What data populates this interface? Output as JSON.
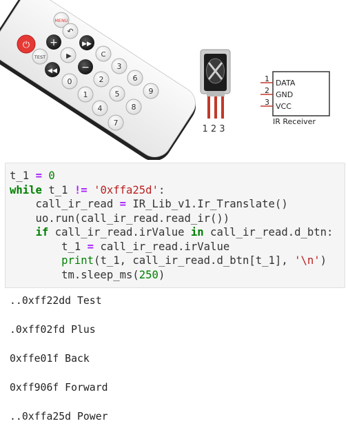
{
  "remote": {
    "buttons": [
      {
        "name": "power",
        "label": ""
      },
      {
        "name": "menu",
        "label": "MENU"
      },
      {
        "name": "test",
        "label": "TEST"
      },
      {
        "name": "plus",
        "label": "+"
      },
      {
        "name": "back",
        "label": ""
      },
      {
        "name": "play",
        "label": ""
      },
      {
        "name": "forward",
        "label": ""
      },
      {
        "name": "rewind",
        "label": ""
      },
      {
        "name": "minus",
        "label": "−"
      },
      {
        "name": "clear",
        "label": "C"
      },
      {
        "name": "0",
        "label": "0"
      },
      {
        "name": "1",
        "label": "1"
      },
      {
        "name": "2",
        "label": "2"
      },
      {
        "name": "3",
        "label": "3"
      },
      {
        "name": "4",
        "label": "4"
      },
      {
        "name": "5",
        "label": "5"
      },
      {
        "name": "6",
        "label": "6"
      },
      {
        "name": "7",
        "label": "7"
      },
      {
        "name": "8",
        "label": "8"
      },
      {
        "name": "9",
        "label": "9"
      }
    ]
  },
  "sensor": {
    "pins_label": "1 2 3"
  },
  "receiver_diagram": {
    "pins": [
      {
        "num": "1",
        "label": "DATA"
      },
      {
        "num": "2",
        "label": "GND"
      },
      {
        "num": "3",
        "label": "VCC"
      }
    ],
    "caption": "IR Receiver"
  },
  "code": {
    "line1": {
      "a": "t_1 ",
      "op": "=",
      "num": "0"
    },
    "line2": {
      "kw": "while",
      "b": " t_1 ",
      "op": "!=",
      "c": " ",
      "str": "'0xffa25d'",
      "d": ":"
    },
    "line3": {
      "a": "    call_ir_read ",
      "op": "=",
      "b": " IR_Lib_v1.Ir_Translate()"
    },
    "line4": {
      "a": "    uo.run(call_ir_read.read_ir())"
    },
    "line5": {
      "a": "    ",
      "kw": "if",
      "b": " call_ir_read.irValue ",
      "kw2": "in",
      "c": " call_ir_read.d_btn:"
    },
    "line6": {
      "a": "        t_1 ",
      "op": "=",
      "b": " call_ir_read.irValue"
    },
    "line7": {
      "a": "        ",
      "bi": "print",
      "b": "(t_1, call_ir_read.d_btn[t_1], ",
      "str": "'\\n'",
      "c": ")"
    },
    "line8": {
      "a": "        tm.sleep_ms(",
      "num": "250",
      "b": ")"
    }
  },
  "output": [
    "..0xff22dd Test",
    ".0xff02fd Plus",
    "0xffe01f Back",
    "0xff906f Forward",
    "..0xffa25d Power"
  ]
}
